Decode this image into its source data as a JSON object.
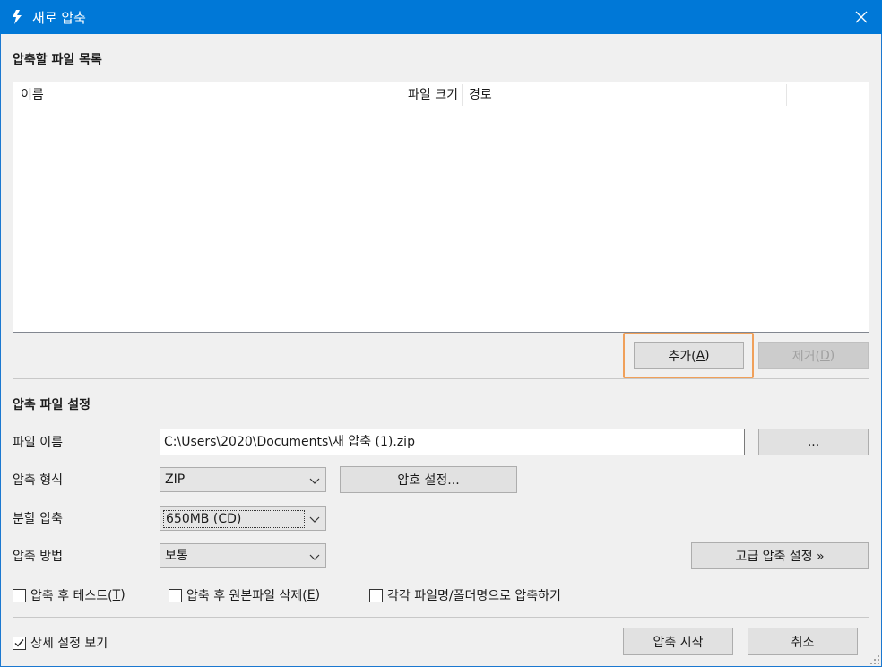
{
  "window": {
    "title": "새로 압축"
  },
  "file_list": {
    "section_title": "압축할 파일 목록",
    "columns": [
      "이름",
      "파일 크기",
      "경로"
    ],
    "add_label": "추가(",
    "add_key": "A",
    "add_suffix": ")",
    "remove_label": "제거(",
    "remove_key": "D",
    "remove_suffix": ")"
  },
  "settings": {
    "section_title": "압축 파일 설정",
    "filename_label": "파일 이름",
    "filename_value": "C:\\Users\\2020\\Documents\\새 압축 (1).zip",
    "browse_label": "...",
    "format_label": "압축 형식",
    "format_value": "ZIP",
    "password_label": "암호 설정...",
    "split_label": "분할 압축",
    "split_value": "650MB (CD)",
    "method_label": "압축 방법",
    "method_value": "보통",
    "advanced_label": "고급 압축 설정 »"
  },
  "options": {
    "test_label": "압축 후 테스트(",
    "test_key": "T",
    "test_suffix": ")",
    "test_checked": false,
    "delete_label": "압축 후 원본파일 삭제(",
    "delete_key": "E",
    "delete_suffix": ")",
    "delete_checked": false,
    "each_label": "각각 파일명/폴더명으로 압축하기",
    "each_checked": false
  },
  "footer": {
    "detail_label": "상세 설정 보기",
    "detail_checked": true,
    "start_label": "압축 시작",
    "cancel_label": "취소"
  },
  "colors": {
    "titlebar": "#0078d7",
    "focus": "#f0a05a"
  }
}
